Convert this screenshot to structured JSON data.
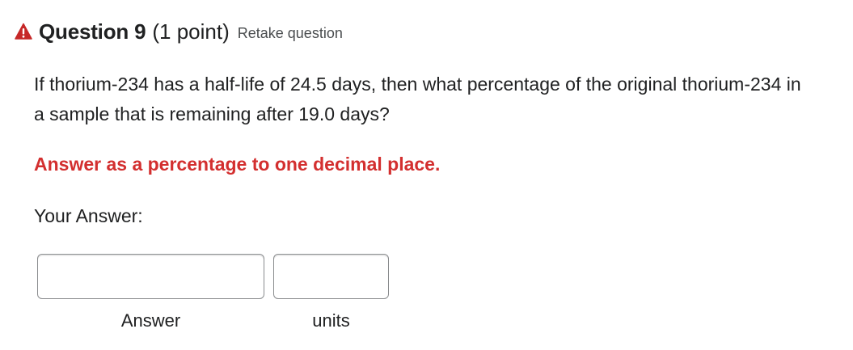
{
  "question": {
    "icon": "warning-icon",
    "icon_color": "#c62828",
    "title": "Question 9",
    "points": "(1 point)",
    "retake_label": "Retake question",
    "text": "If thorium-234 has a half-life of 24.5 days, then what percentage of the original thorium-234 in a sample that is remaining after 19.0 days?",
    "instruction": "Answer as a percentage to one decimal place.",
    "instruction_color": "#d32f2f"
  },
  "answer": {
    "prompt": "Your Answer:",
    "value_field": {
      "value": "",
      "label": "Answer"
    },
    "units_field": {
      "value": "",
      "label": "units"
    }
  }
}
